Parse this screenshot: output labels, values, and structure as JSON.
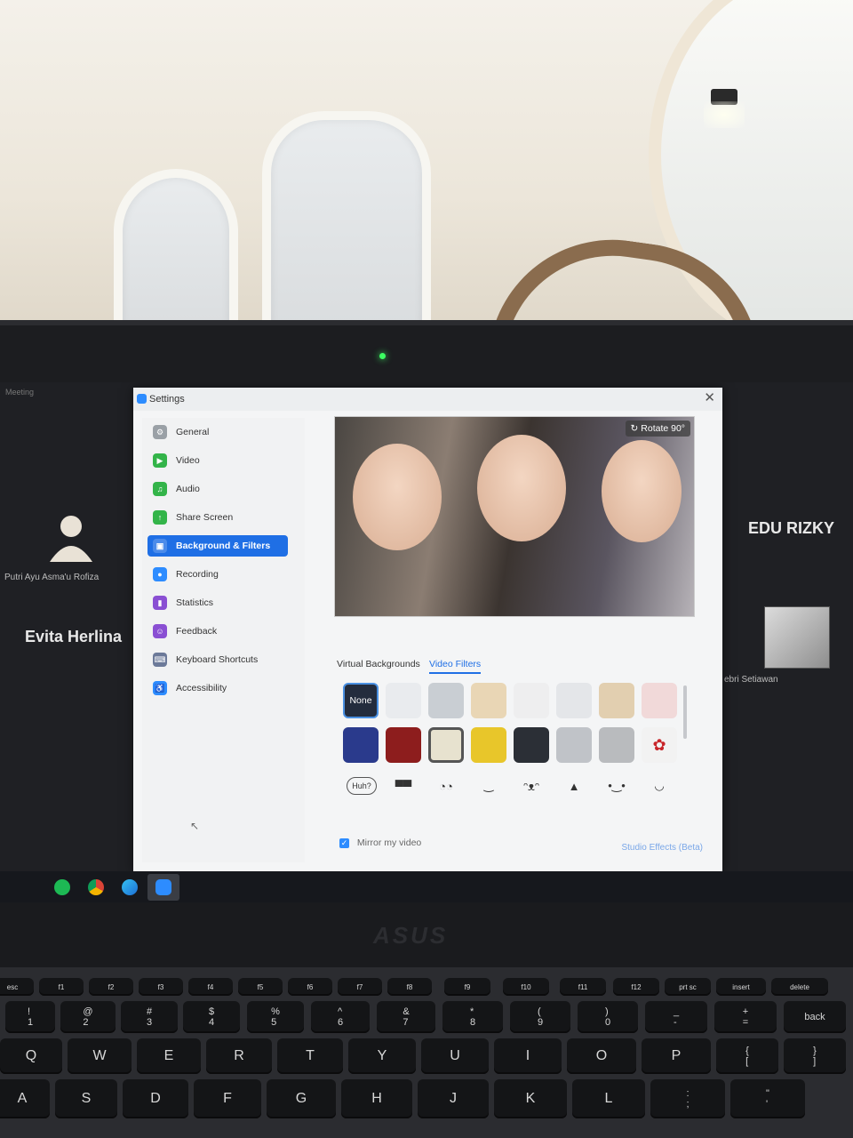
{
  "screen": {
    "window_label": "Meeting"
  },
  "participants": {
    "left_small_name": "Putri Ayu Asma'u Rofiza",
    "left_big_name": "Evita Herlina",
    "right_big_name": "EDU RIZKY",
    "right_small_name": "ebri Setiawan"
  },
  "settings": {
    "title": "Settings",
    "close_glyph": "✕",
    "nav": [
      {
        "label": "General",
        "icon": "gear-icon",
        "color": "#9aa0a6"
      },
      {
        "label": "Video",
        "icon": "video-camera-icon",
        "color": "#33b449"
      },
      {
        "label": "Audio",
        "icon": "headphones-icon",
        "color": "#33b449"
      },
      {
        "label": "Share Screen",
        "icon": "share-screen-icon",
        "color": "#33b449"
      },
      {
        "label": "Background & Filters",
        "icon": "person-background-icon",
        "color": "#1f6fe5"
      },
      {
        "label": "Recording",
        "icon": "record-icon",
        "color": "#2d8cff"
      },
      {
        "label": "Statistics",
        "icon": "bar-chart-icon",
        "color": "#8a4fd3"
      },
      {
        "label": "Feedback",
        "icon": "smiley-icon",
        "color": "#8a4fd3"
      },
      {
        "label": "Keyboard Shortcuts",
        "icon": "keyboard-icon",
        "color": "#6c7a99"
      },
      {
        "label": "Accessibility",
        "icon": "accessibility-icon",
        "color": "#2d8cff"
      }
    ],
    "active_nav_index": 4,
    "rotate_label": "Rotate 90°",
    "tabs": {
      "virtual_backgrounds": "Virtual Backgrounds",
      "video_filters": "Video Filters",
      "active": "Video Filters"
    },
    "filters_none_label": "None",
    "filter_row1_colors": [
      "#e9ebee",
      "#c9ced3",
      "#e9d6b5",
      "#eeeeef",
      "#e4e6e9",
      "#e2cfb0",
      "#f1d9d9"
    ],
    "filter_row2_colors": [
      "#2a3a8c",
      "#8d1d1d",
      "#e7e2cf",
      "#e8c62a",
      "#2b2f36",
      "#c0c3c8",
      "#b9bbbe",
      "#f2f2f2"
    ],
    "stickers": [
      "Huh?",
      "▀▀",
      "◔◔",
      "‿",
      "ᵔᴥᵔ",
      "▲",
      "•‿•",
      "◡"
    ],
    "mirror_label": "Mirror my video",
    "mirror_checked": true,
    "studio_effects_label": "Studio Effects (Beta)"
  },
  "taskbar": {
    "apps": [
      {
        "name": "spotify-icon",
        "color": "#1db954"
      },
      {
        "name": "chrome-icon",
        "color": "#e6b120"
      },
      {
        "name": "edge-icon",
        "color": "#1d8ad6"
      },
      {
        "name": "zoom-icon",
        "color": "#2d8cff"
      }
    ]
  },
  "laptop": {
    "brand": "ASUS"
  },
  "keyboard": {
    "fn_row": [
      "esc",
      "f1",
      "f2",
      "f3",
      "f4",
      "f5",
      "f6",
      "f7",
      "f8",
      "f9",
      "f10",
      "f11",
      "f12",
      "prt sc",
      "insert",
      "delete"
    ],
    "number_row": [
      "!\n1",
      "@\n2",
      "#\n3",
      "$\n4",
      "%\n5",
      "^\n6",
      "&\n7",
      "*\n8",
      "(\n9",
      ")\n0",
      "_\n-",
      "+\n=",
      "back"
    ],
    "qwerty_row": [
      "Q",
      "W",
      "E",
      "R",
      "T",
      "Y",
      "U",
      "I",
      "O",
      "P",
      "{\n[",
      "}\n]"
    ],
    "home_row": [
      "A",
      "S",
      "D",
      "F",
      "G",
      "H",
      "J",
      "K",
      "L",
      ":\n;",
      "\"\n'"
    ]
  }
}
